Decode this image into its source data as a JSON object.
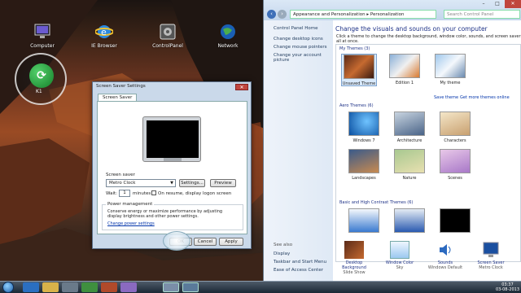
{
  "desktop": {
    "icons": [
      {
        "label": "Computer"
      },
      {
        "label": "IE Browser"
      },
      {
        "label": "ControlPanel"
      },
      {
        "label": "Network"
      }
    ],
    "gadget_label": "K1"
  },
  "dialog": {
    "title": "Screen Saver Settings",
    "tab": "Screen Saver",
    "screen_saver_label": "Screen saver",
    "screen_saver_value": "Metro Clock",
    "settings_btn": "Settings...",
    "preview_btn": "Preview",
    "wait_label": "Wait:",
    "wait_value": "1",
    "minutes_label": "minutes",
    "resume_label": "On resume, display logon screen",
    "power_title": "Power management",
    "power_text": "Conserve energy or maximize performance by adjusting display brightness and other power settings.",
    "power_link": "Change power settings",
    "ok_btn": "OK",
    "cancel_btn": "Cancel",
    "apply_btn": "Apply"
  },
  "control_panel": {
    "address": "Appearance and Personalization  ▸  Personalization",
    "search_placeholder": "Search Control Panel",
    "left_links": [
      "Control Panel Home",
      "Change desktop icons",
      "Change mouse pointers",
      "Change your account picture"
    ],
    "see_also_title": "See also",
    "see_also": [
      "Display",
      "Taskbar and Start Menu",
      "Ease of Access Center"
    ],
    "heading": "Change the visuals and sounds on your computer",
    "subheading": "Click a theme to change the desktop background, window color, sounds, and screen saver all at once.",
    "groups": {
      "my_themes": "My Themes (3)",
      "aero_themes": "Aero Themes (6)",
      "basic_themes": "Basic and High Contrast Themes (6)"
    },
    "my_themes": [
      "Unsaved Theme",
      "Edition 1",
      "My theme"
    ],
    "save_theme_link": "Save theme",
    "get_more_link": "Get more themes online",
    "aero_themes": [
      "Windows 7",
      "Architecture",
      "Characters",
      "Landscapes",
      "Nature",
      "Scenes"
    ],
    "bottom": [
      {
        "title": "Desktop Background",
        "sub": "Slide Show"
      },
      {
        "title": "Window Color",
        "sub": "Sky"
      },
      {
        "title": "Sounds",
        "sub": "Windows Default"
      },
      {
        "title": "Screen Saver",
        "sub": "Metro Clock"
      }
    ]
  },
  "taskbar": {
    "time": "03:37",
    "date": "03-08-2013"
  },
  "colors": {
    "accent": "#1e3287",
    "link": "#0033aa",
    "taskbar": "#1b2835"
  }
}
